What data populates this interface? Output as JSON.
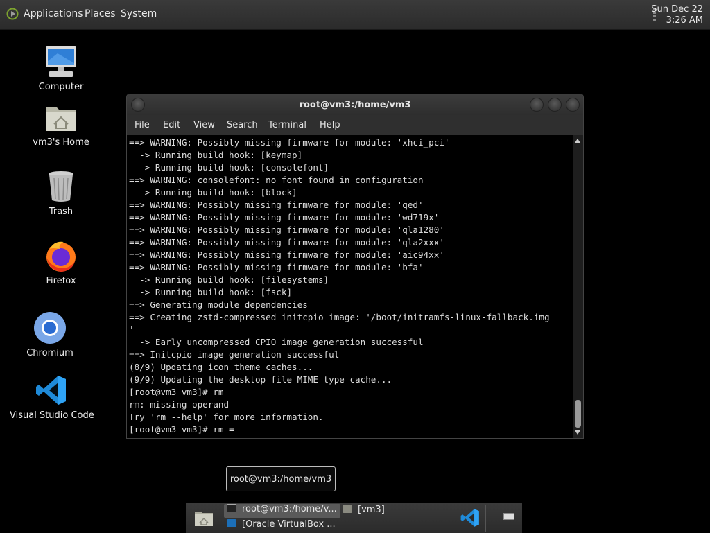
{
  "top_panel": {
    "menus": [
      "Applications",
      "Places",
      "System"
    ],
    "clock": {
      "date": "Sun Dec 22",
      "time": "3:26 AM"
    }
  },
  "desktop_icons": [
    {
      "label": "Computer",
      "icon": "computer-icon"
    },
    {
      "label": "vm3's Home",
      "icon": "home-folder-icon"
    },
    {
      "label": "Trash",
      "icon": "trash-icon"
    },
    {
      "label": "Firefox",
      "icon": "firefox-icon"
    },
    {
      "label": "Chromium",
      "icon": "chromium-icon"
    },
    {
      "label": "Visual Studio Code",
      "icon": "vscode-icon"
    }
  ],
  "terminal": {
    "title": "root@vm3:/home/vm3",
    "menu": [
      "File",
      "Edit",
      "View",
      "Search",
      "Terminal",
      "Help"
    ],
    "lines": [
      "==> WARNING: Possibly missing firmware for module: 'xhci_pci'",
      "  -> Running build hook: [keymap]",
      "  -> Running build hook: [consolefont]",
      "==> WARNING: consolefont: no font found in configuration",
      "  -> Running build hook: [block]",
      "==> WARNING: Possibly missing firmware for module: 'qed'",
      "==> WARNING: Possibly missing firmware for module: 'wd719x'",
      "==> WARNING: Possibly missing firmware for module: 'qla1280'",
      "==> WARNING: Possibly missing firmware for module: 'qla2xxx'",
      "==> WARNING: Possibly missing firmware for module: 'aic94xx'",
      "==> WARNING: Possibly missing firmware for module: 'bfa'",
      "  -> Running build hook: [filesystems]",
      "  -> Running build hook: [fsck]",
      "==> Generating module dependencies",
      "==> Creating zstd-compressed initcpio image: '/boot/initramfs-linux-fallback.img",
      "'",
      "  -> Early uncompressed CPIO image generation successful",
      "==> Initcpio image generation successful",
      "(8/9) Updating icon theme caches...",
      "(9/9) Updating the desktop file MIME type cache...",
      "[root@vm3 vm3]# rm",
      "rm: missing operand",
      "Try 'rm --help' for more information.",
      "[root@vm3 vm3]# rm ="
    ]
  },
  "tooltip": {
    "text": "root@vm3:/home/vm3"
  },
  "taskbar": {
    "tasks": [
      {
        "label": "root@vm3:/home/v...",
        "icon": "terminal-icon",
        "active": true
      },
      {
        "label": "[vm3]",
        "icon": "folder-icon",
        "active": false
      },
      {
        "label": "[Oracle VirtualBox ...",
        "icon": "virtualbox-icon",
        "active": false
      }
    ]
  },
  "colors": {
    "panel": "#2f2f2f",
    "terminal_bg": "#000000",
    "text": "#dcdcdc"
  }
}
